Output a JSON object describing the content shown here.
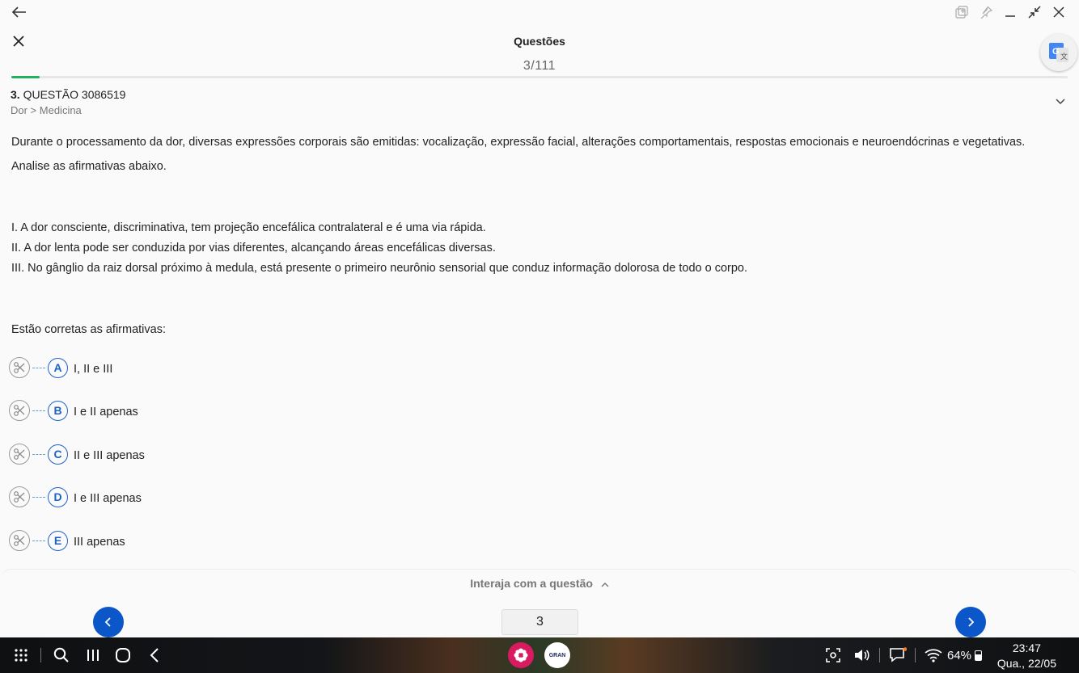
{
  "window": {
    "back_icon": "arrow-left-icon",
    "controls": [
      "pop-out-icon",
      "pin-icon",
      "minimize-icon",
      "collapse-icon",
      "close-icon"
    ]
  },
  "header": {
    "title": "Questões",
    "counter": "3/111",
    "close_icon": "close-icon",
    "translate_icon": "google-translate-icon"
  },
  "progress": {
    "current": 3,
    "total": 111,
    "fraction": 0.027
  },
  "question": {
    "number": "3.",
    "label": "QUESTÃO 3086519",
    "breadcrumb": "Dor > Medicina",
    "intro": "Durante o processamento da dor, diversas expressões corporais são emitidas: vocalização, expressão facial, alterações comportamentais, respostas emocionais e neuroendócrinas e vegetativas.",
    "instruction": "Analise as afirmativas abaixo.",
    "statements": [
      "I. A dor consciente, discriminativa, tem projeção encefálica contralateral e é uma via rápida.",
      "II. A dor lenta pode ser conduzida por vias diferentes, alcançando áreas encefálicas diversas.",
      "III. No gânglio da raiz dorsal próximo à medula, está presente o primeiro neurônio sensorial que conduz informação dolorosa de todo o corpo."
    ],
    "prompt": "Estão corretas as afirmativas:",
    "options": [
      {
        "letter": "A",
        "text": "I, II e III"
      },
      {
        "letter": "B",
        "text": "I e II apenas"
      },
      {
        "letter": "C",
        "text": "II e III apenas"
      },
      {
        "letter": "D",
        "text": "I e III apenas"
      },
      {
        "letter": "E",
        "text": "III apenas"
      }
    ]
  },
  "footer": {
    "interact_label": "Interaja com a questão",
    "page_value": "3",
    "prev_icon": "chevron-left-icon",
    "next_icon": "chevron-right-icon"
  },
  "taskbar": {
    "battery": "64%",
    "time": "23:47",
    "date": "Qua., 22/05",
    "apps": [
      "flower-app-icon",
      "gran-app-icon"
    ],
    "gran_text": "GRAN"
  },
  "colors": {
    "accent": "#0b56c8",
    "progress": "#21b35c",
    "option_letter": "#1d63c4"
  }
}
